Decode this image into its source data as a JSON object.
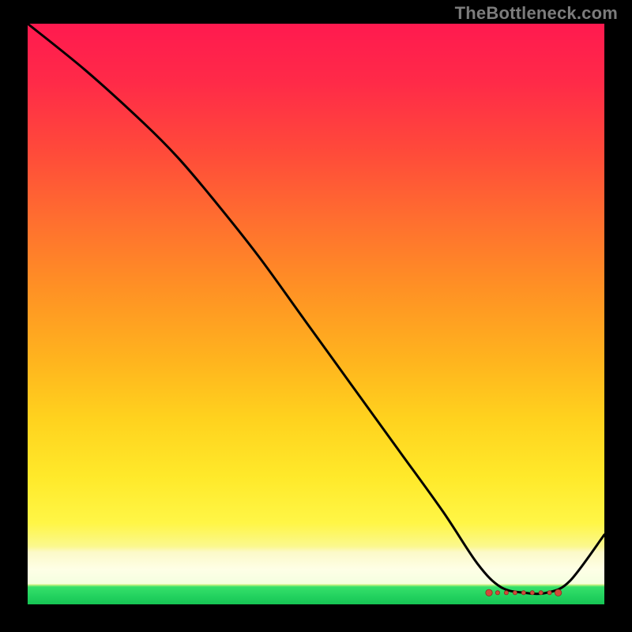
{
  "watermark": "TheBottleneck.com",
  "chart_data": {
    "type": "line",
    "title": "",
    "xlabel": "",
    "ylabel": "",
    "xlim": [
      0,
      100
    ],
    "ylim": [
      0,
      100
    ],
    "grid": false,
    "legend": false,
    "note": "No axes, ticks or numeric labels are rendered; values below are read as percentages of the plot area (0 = bottom/left, 100 = top/right).",
    "series": [
      {
        "name": "curve",
        "x": [
          0,
          10,
          20,
          26,
          32,
          40,
          48,
          56,
          64,
          72,
          78,
          82,
          86,
          90,
          94,
          100
        ],
        "y": [
          100,
          92,
          83,
          77,
          70,
          60,
          49,
          38,
          27,
          16,
          7,
          3,
          2,
          2,
          4,
          12
        ]
      }
    ],
    "flat_region": {
      "name": "highlighted-minimum",
      "x_start": 80,
      "x_end": 92,
      "y": 2
    },
    "colors": {
      "curve": "#000000",
      "dots": "#d24a3a",
      "gradient_top": "#ff1a4f",
      "gradient_mid": "#ffe92a",
      "gradient_bottom": "#22d15e",
      "frame": "#000000"
    }
  }
}
